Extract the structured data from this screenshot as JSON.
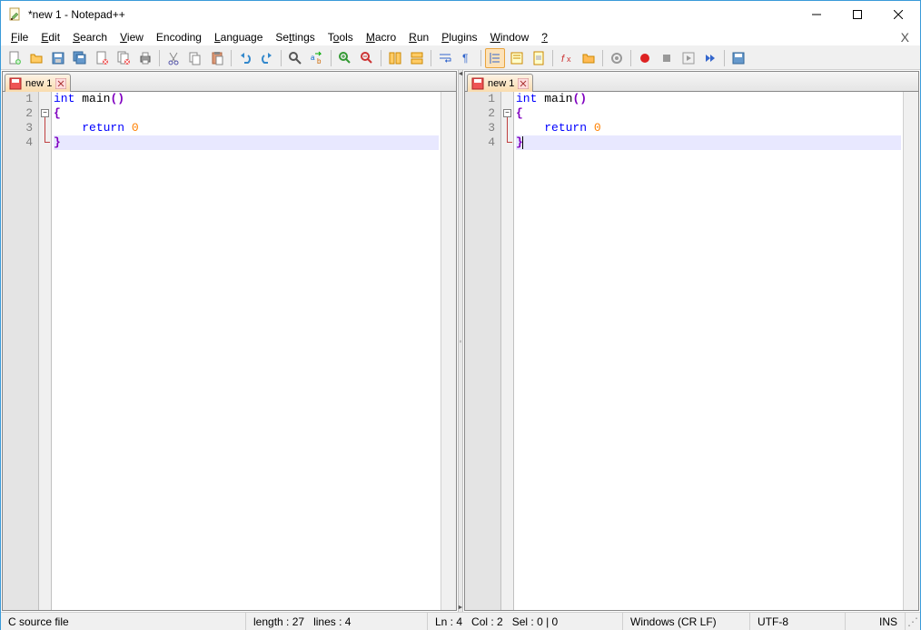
{
  "window": {
    "title": "*new 1 - Notepad++"
  },
  "menu": {
    "items": [
      "File",
      "Edit",
      "Search",
      "View",
      "Encoding",
      "Language",
      "Settings",
      "Tools",
      "Macro",
      "Run",
      "Plugins",
      "Window",
      "?"
    ]
  },
  "tabs": {
    "left": {
      "label": "new 1"
    },
    "right": {
      "label": "new 1"
    }
  },
  "code": {
    "lines": [
      {
        "n": 1,
        "tokens": [
          {
            "t": "int",
            "c": "kw-type"
          },
          {
            "t": " "
          },
          {
            "t": "main",
            "c": "fn"
          },
          {
            "t": "(",
            "c": "paren"
          },
          {
            "t": ")",
            "c": "paren"
          }
        ]
      },
      {
        "n": 2,
        "tokens": [
          {
            "t": "{",
            "c": "brace"
          }
        ]
      },
      {
        "n": 3,
        "tokens": [
          {
            "t": "    "
          },
          {
            "t": "return",
            "c": "kw-ret"
          },
          {
            "t": " "
          },
          {
            "t": "0",
            "c": "num"
          }
        ]
      },
      {
        "n": 4,
        "tokens": [
          {
            "t": "}",
            "c": "brace"
          }
        ],
        "highlight": true
      }
    ]
  },
  "status": {
    "filetype": "C source file",
    "length_label": "length : 27",
    "lines_label": "lines : 4",
    "pos_ln": "Ln : 4",
    "pos_col": "Col : 2",
    "pos_sel": "Sel : 0 | 0",
    "eol": "Windows (CR LF)",
    "encoding": "UTF-8",
    "insert": "INS"
  },
  "toolbar_icons": [
    "new",
    "open",
    "save",
    "save-all",
    "close",
    "close-all",
    "print",
    "sep",
    "cut",
    "copy",
    "paste",
    "sep",
    "undo",
    "redo",
    "sep",
    "find",
    "replace",
    "sep",
    "zoom-in",
    "zoom-out",
    "sep",
    "sync-v",
    "sync-h",
    "sep",
    "wrap",
    "all-chars",
    "sep",
    "indent-guide",
    "lang",
    "doc-map",
    "sep",
    "func-list",
    "folder",
    "sep",
    "monitor",
    "sep",
    "record",
    "stop",
    "play",
    "play-multi",
    "sep",
    "save-macro"
  ]
}
